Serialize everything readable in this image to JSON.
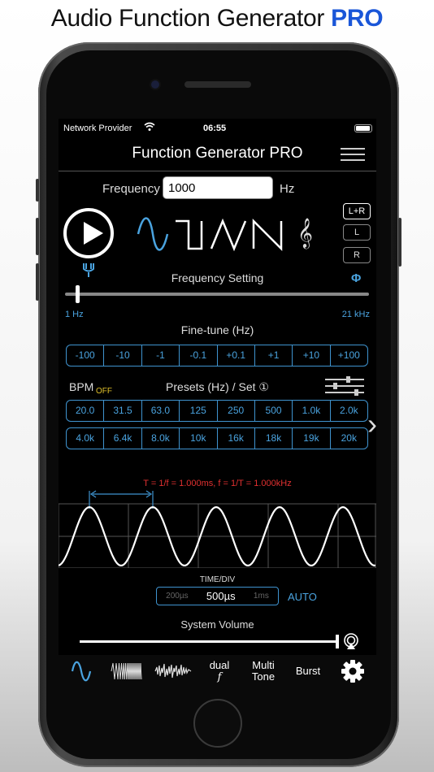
{
  "banner": {
    "title": "Audio Function Generator",
    "pro": "PRO"
  },
  "status": {
    "carrier": "Network Provider",
    "time": "06:55",
    "wifi_icon": "wifi-icon",
    "battery_icon": "battery-icon"
  },
  "app": {
    "title": "Function Generator PRO"
  },
  "frequency": {
    "label": "Frequency",
    "value": "1000",
    "unit": "Hz"
  },
  "waveforms": [
    "sine",
    "square",
    "triangle",
    "sawtooth"
  ],
  "channels": [
    {
      "label": "L+R",
      "active": true
    },
    {
      "label": "L"
    },
    {
      "label": "R"
    }
  ],
  "freq_setting": {
    "label": "Frequency Setting",
    "phase_symbol": "Φ",
    "min_label": "1 Hz",
    "max_label": "21 kHz"
  },
  "finetune": {
    "label": "Fine-tune (Hz)",
    "buttons": [
      "-100",
      "-10",
      "-1",
      "-0.1",
      "+0.1",
      "+1",
      "+10",
      "+100"
    ]
  },
  "bpm": {
    "label": "BPM",
    "state": "OFF"
  },
  "presets": {
    "label": "Presets (Hz) / Set ①",
    "row1": [
      "20.0",
      "31.5",
      "63.0",
      "125",
      "250",
      "500",
      "1.0k",
      "2.0k"
    ],
    "row2": [
      "4.0k",
      "6.4k",
      "8.0k",
      "10k",
      "16k",
      "18k",
      "19k",
      "20k"
    ]
  },
  "scope": {
    "measurement": "T = 1/f = 1.000ms, f = 1/T = 1.000kHz",
    "wave_color": "#ffffff",
    "grid_color": "#555555",
    "marker_color": "#3f93cf"
  },
  "timediv": {
    "label": "TIME/DIV",
    "options": [
      "200µs",
      "500µs",
      "1ms"
    ],
    "selected": "500µs",
    "auto": "AUTO"
  },
  "volume": {
    "label": "System Volume",
    "level": 0.98
  },
  "tabs": [
    {
      "id": "sine-tab",
      "icon": "sine-wave-icon"
    },
    {
      "id": "sweep-tab",
      "icon": "sweep-icon"
    },
    {
      "id": "noise-tab",
      "icon": "noise-icon"
    },
    {
      "id": "dual-tab",
      "line1": "dual",
      "line2": "f"
    },
    {
      "id": "multitone-tab",
      "line1": "Multi",
      "line2": "Tone"
    },
    {
      "id": "burst-tab",
      "line1": "Burst"
    },
    {
      "id": "settings-tab",
      "icon": "gear-icon"
    }
  ],
  "colors": {
    "accent": "#4aa3df",
    "bpm_off": "#e0c02a",
    "measure": "#e03030",
    "pro": "#1a56d8"
  }
}
